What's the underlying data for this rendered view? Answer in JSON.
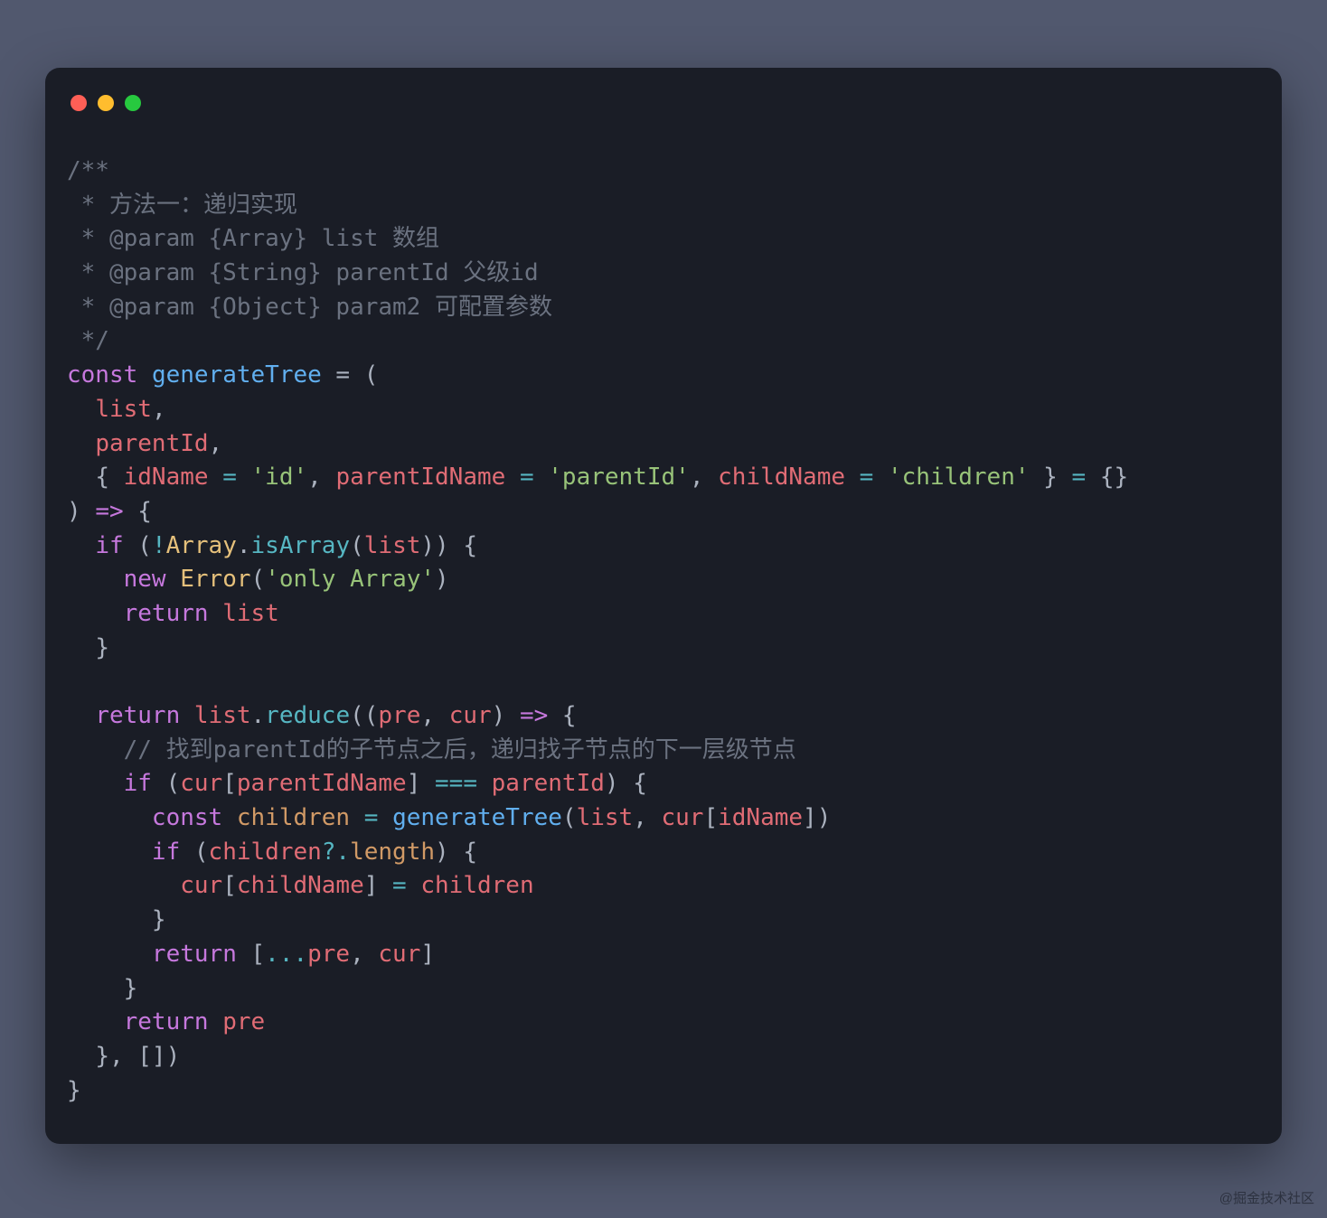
{
  "window": {
    "traffic_lights": [
      "close",
      "minimize",
      "maximize"
    ]
  },
  "code": {
    "comment_block": {
      "start": "/**",
      "l1": " * 方法一：递归实现",
      "l2": " * @param {Array} list 数组",
      "l3": " * @param {String} parentId 父级id",
      "l4": " * @param {Object} param2 可配置参数",
      "end": " */"
    },
    "decl": {
      "kw_const": "const",
      "fn_name": "generateTree",
      "assign": " = ("
    },
    "params": {
      "list": "list",
      "parentId": "parentId",
      "destructure": {
        "open": "{ ",
        "idName": "idName",
        "idName_def": "'id'",
        "parentIdName": "parentIdName",
        "parentIdName_def": "'parentId'",
        "childName": "childName",
        "childName_def": "'children'",
        "close": " } ",
        "default_obj": "{}"
      }
    },
    "arrow": ") => {",
    "guard": {
      "if_kw": "if",
      "open": " (",
      "not": "!",
      "Array": "Array",
      "dot": ".",
      "isArray": "isArray",
      "call_open": "(",
      "list_arg": "list",
      "call_close": ")) {",
      "new_kw": "new",
      "Error": "Error",
      "err_msg": "'only Array'",
      "return_kw": "return",
      "return_val": "list",
      "close": "}"
    },
    "reduce": {
      "return_kw": "return",
      "list": "list",
      "dot": ".",
      "reduce": "reduce",
      "open": "((",
      "pre": "pre",
      "cur": "cur",
      "arrow": ") => {",
      "comment": "// 找到parentId的子节点之后，递归找子节点的下一层级节点",
      "if_kw": "if",
      "cond_open": " (",
      "cur2": "cur",
      "bracket_open": "[",
      "parentIdName": "parentIdName",
      "bracket_close": "]",
      "eq": " === ",
      "parentId": "parentId",
      "cond_close": ") {",
      "const_kw": "const",
      "children_var": "children",
      "assign": " = ",
      "call_fn": "generateTree",
      "call_open": "(",
      "call_list": "list",
      "call_cur": "cur",
      "call_idName": "idName",
      "call_close": ")",
      "if2_kw": "if",
      "if2_open": " (",
      "children2": "children",
      "optchain": "?.",
      "length": "length",
      "if2_close": ") {",
      "cur3": "cur",
      "childName": "childName",
      "assign2": " = ",
      "children3": "children",
      "close_if2": "}",
      "return2_kw": "return",
      "spread_open": " [",
      "spread": "...",
      "pre2": "pre",
      "comma": ", ",
      "cur4": "cur",
      "spread_close": "]",
      "close_if": "}",
      "return3_kw": "return",
      "pre3": "pre",
      "reduce_close": "}, [])",
      "fn_close": "}"
    }
  },
  "watermark": "@掘金技术社区"
}
